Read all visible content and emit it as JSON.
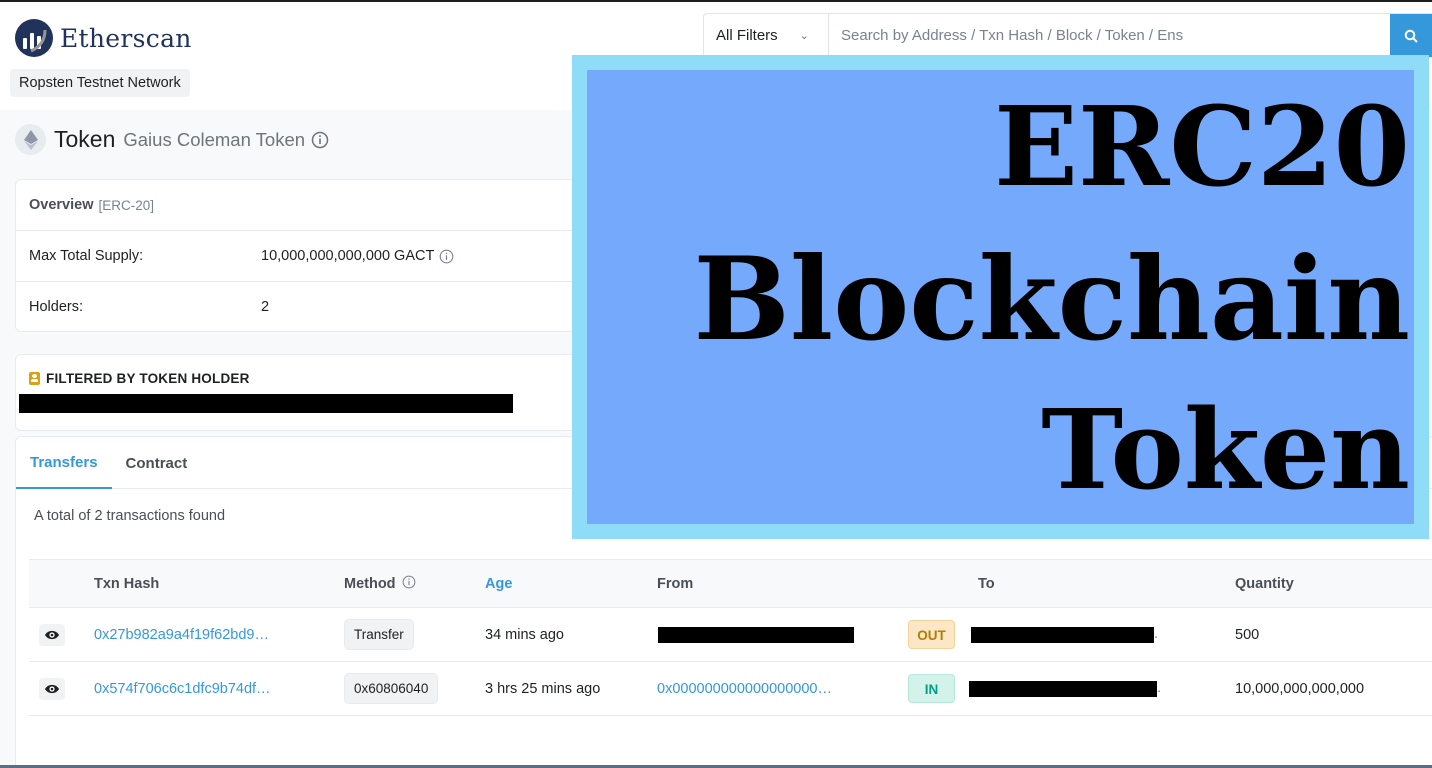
{
  "header": {
    "logo_text": "Etherscan",
    "network": "Ropsten Testnet Network",
    "filter": "All Filters",
    "search_placeholder": "Search by Address / Txn Hash / Block / Token / Ens",
    "accent_color": "#3498db"
  },
  "token": {
    "label": "Token",
    "name": "Gaius Coleman Token"
  },
  "overview": {
    "title": "Overview",
    "standard": "[ERC-20]",
    "rows": [
      {
        "label": "Max Total Supply:",
        "value": "10,000,000,000,000 GACT"
      },
      {
        "label": "Holders:",
        "value": "2"
      }
    ]
  },
  "filter_card": {
    "heading": "FILTERED BY TOKEN HOLDER"
  },
  "tabs": [
    {
      "label": "Transfers",
      "active": true
    },
    {
      "label": "Contract",
      "active": false
    }
  ],
  "transfers": {
    "summary": "A total of 2 transactions found",
    "columns": {
      "txn_hash": "Txn Hash",
      "method": "Method",
      "age": "Age",
      "from": "From",
      "to": "To",
      "quantity": "Quantity"
    },
    "rows": [
      {
        "hash": "0x27b982a9a4f19f62bd9…",
        "method": "Transfer",
        "age": "34 mins ago",
        "from": "",
        "direction": "OUT",
        "quantity": "500"
      },
      {
        "hash": "0x574f706c6c1dfc9b74df…",
        "method": "0x60806040",
        "age": "3 hrs 25 mins ago",
        "from": "0x000000000000000000…",
        "direction": "IN",
        "quantity": "10,000,000,000,000"
      }
    ],
    "direction_colors": {
      "OUT": "#b47d00",
      "IN": "#00a186"
    }
  },
  "banner": {
    "line1": "ERC20",
    "line2": "Blockchain",
    "line3": "Token",
    "outer_color": "#8fdcf8",
    "inner_color": "#74a9fc"
  }
}
